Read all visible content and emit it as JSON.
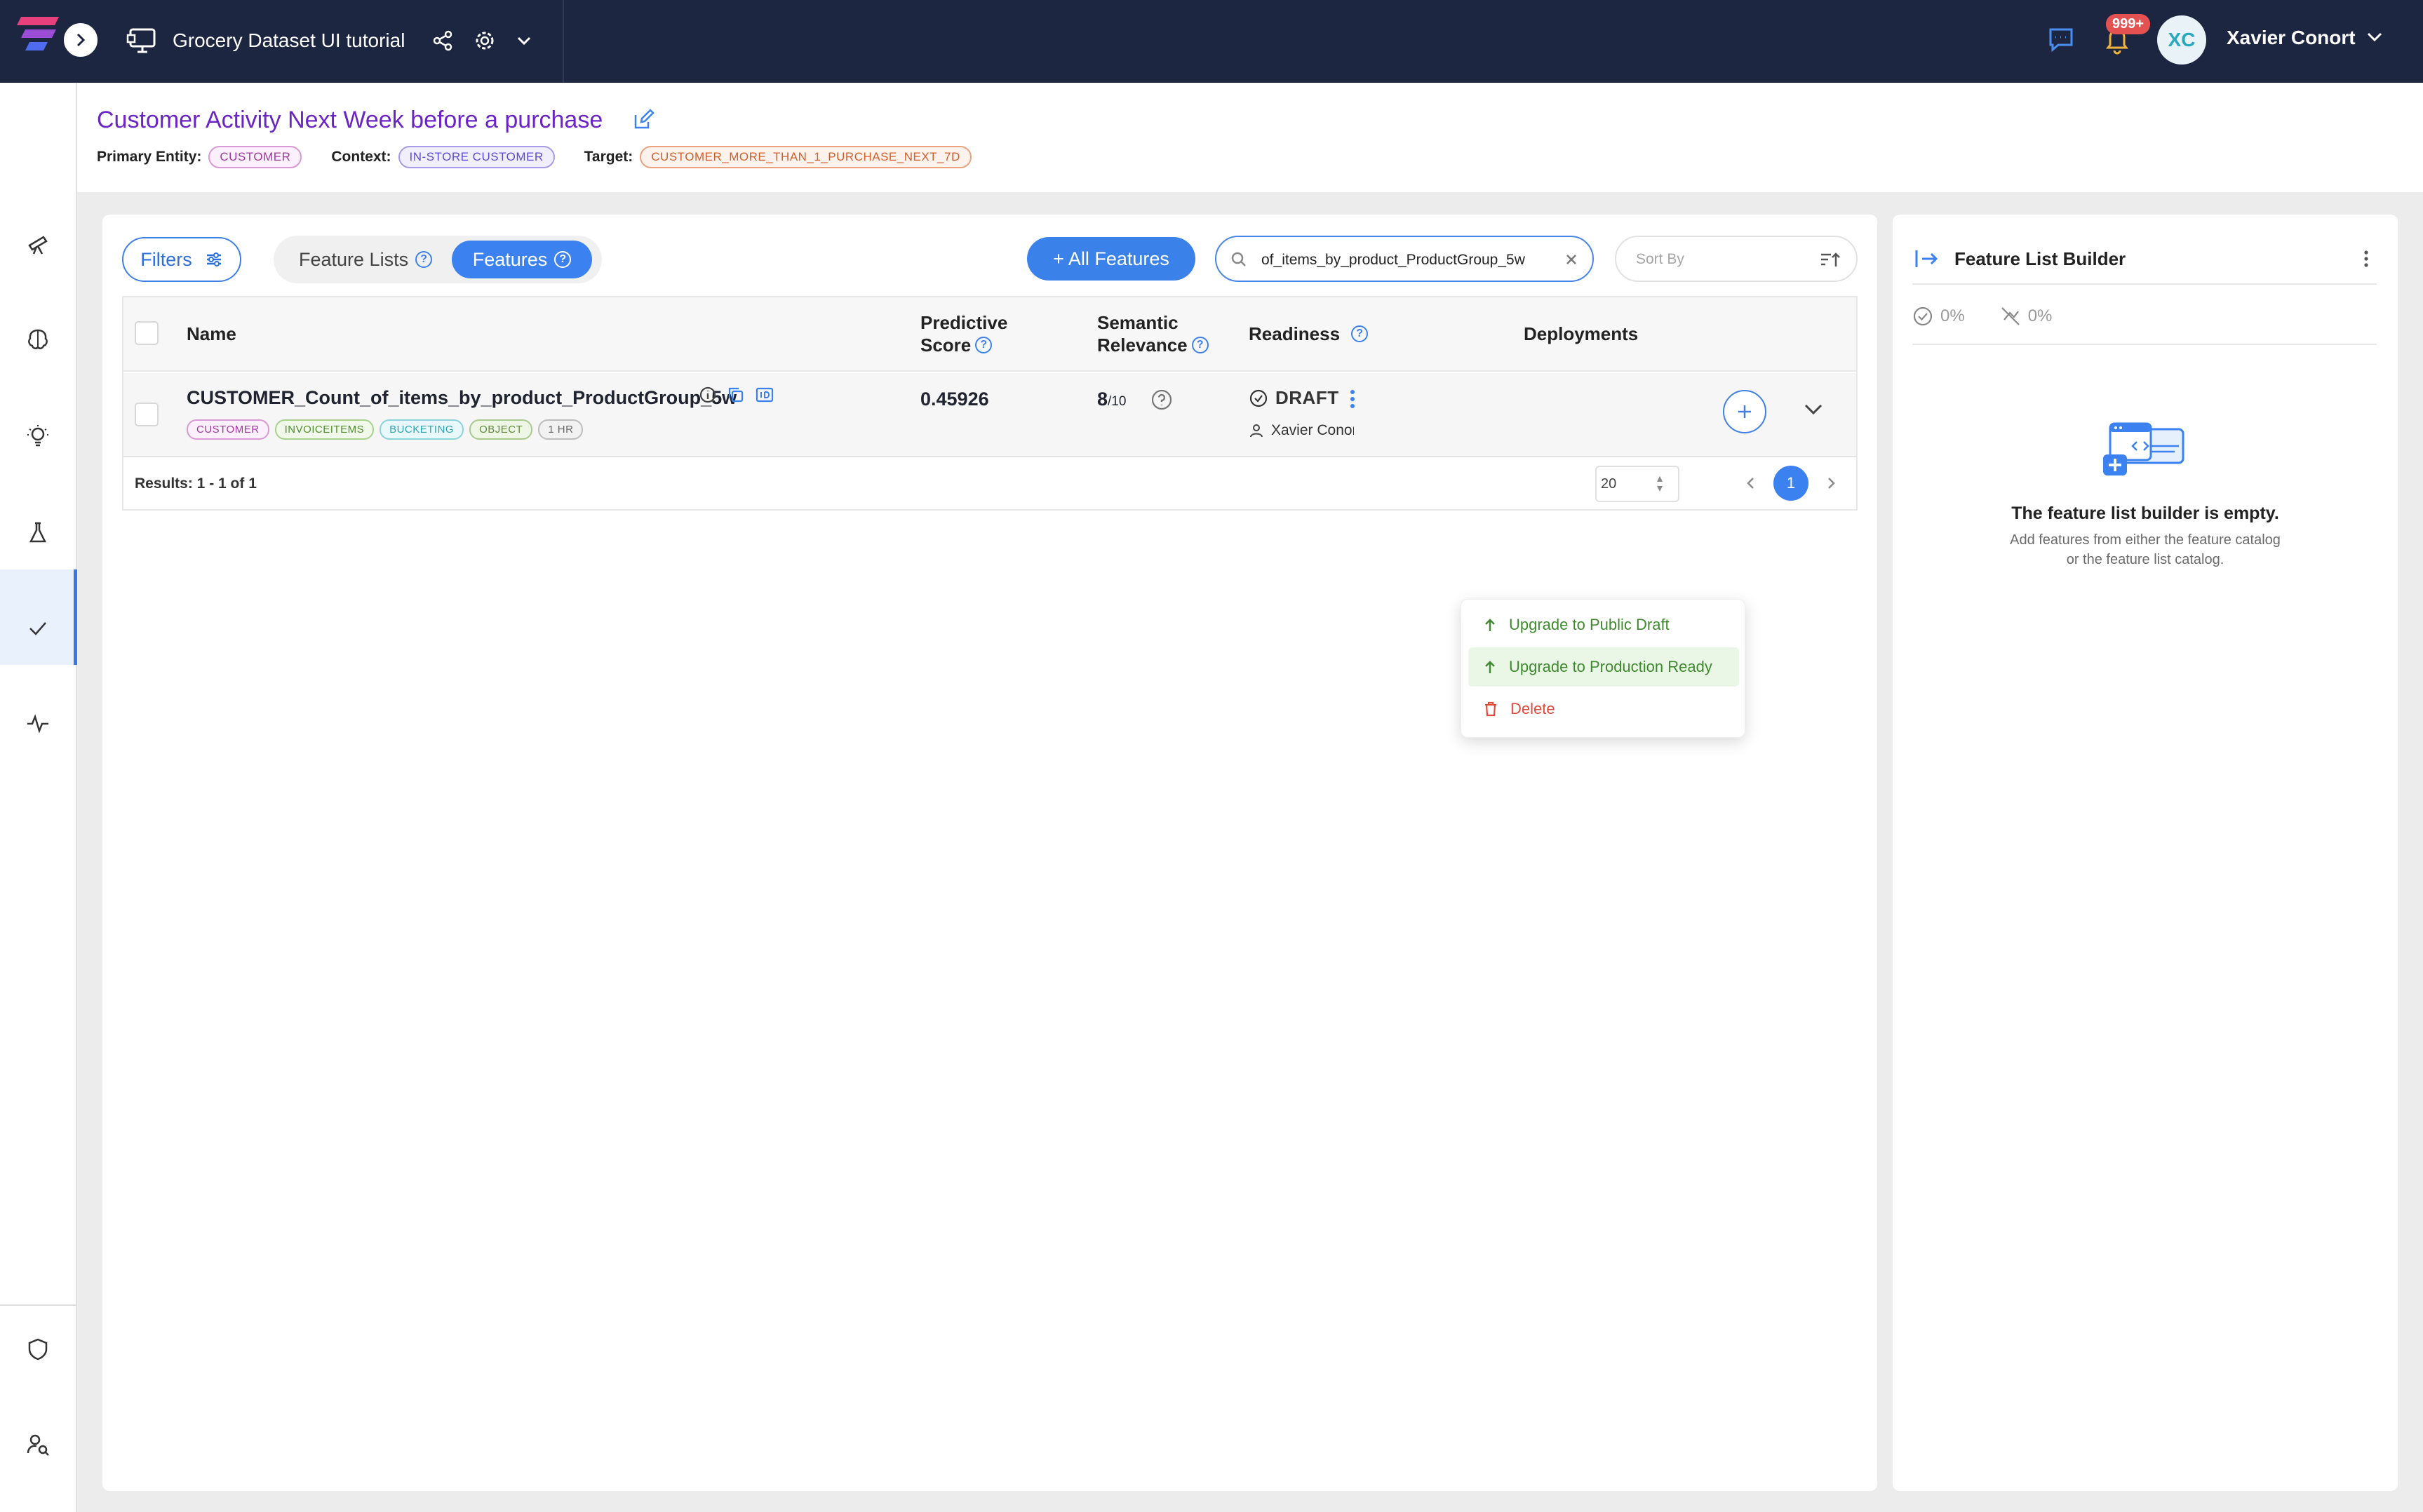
{
  "topbar": {
    "catalog_title": "Grocery Dataset UI tutorial",
    "notification_count": "999+",
    "user_initials": "XC",
    "user_name": "Xavier Conort"
  },
  "header": {
    "title": "Customer Activity Next Week before a purchase",
    "primary_entity_label": "Primary Entity:",
    "primary_entity": "CUSTOMER",
    "context_label": "Context:",
    "context": "IN-STORE CUSTOMER",
    "target_label": "Target:",
    "target": "CUSTOMER_MORE_THAN_1_PURCHASE_NEXT_7D"
  },
  "toolbar": {
    "filters_label": "Filters",
    "tab_feature_lists": "Feature Lists",
    "tab_features": "Features",
    "all_features_label": "+ All Features",
    "search_value": "of_items_by_product_ProductGroup_5w",
    "sort_placeholder": "Sort By"
  },
  "table": {
    "columns": {
      "name": "Name",
      "predictive_line1": "Predictive",
      "predictive_line2": "Score",
      "semantic_line1": "Semantic",
      "semantic_line2": "Relevance",
      "readiness": "Readiness",
      "deployments": "Deployments"
    },
    "rows": [
      {
        "name": "CUSTOMER_Count_of_items_by_product_ProductGroup_5w",
        "tags": [
          "CUSTOMER",
          "INVOICEITEMS",
          "BUCKETING",
          "OBJECT",
          "1 HR"
        ],
        "predictive_score": "0.45926",
        "relevance": "8",
        "relevance_max": "/10",
        "readiness": "DRAFT",
        "owner": "Xavier Conort"
      }
    ],
    "results": "Results: 1 - 1 of 1",
    "page_size": "20",
    "current_page": "1"
  },
  "dropdown": {
    "items": [
      "Upgrade to Public Draft",
      "Upgrade to Production Ready",
      "Delete"
    ]
  },
  "builder": {
    "title": "Feature List Builder",
    "stat_1": "0%",
    "stat_2": "0%",
    "empty_title": "The feature list builder is empty.",
    "empty_hint": "Add features from either the feature catalog or the feature list catalog."
  },
  "colors": {
    "topbar": "#1d2640",
    "accent": "#3b82f0",
    "title_purple": "#6b24c6",
    "success_green": "#3f8a2e",
    "danger_red": "#e24a3b"
  }
}
